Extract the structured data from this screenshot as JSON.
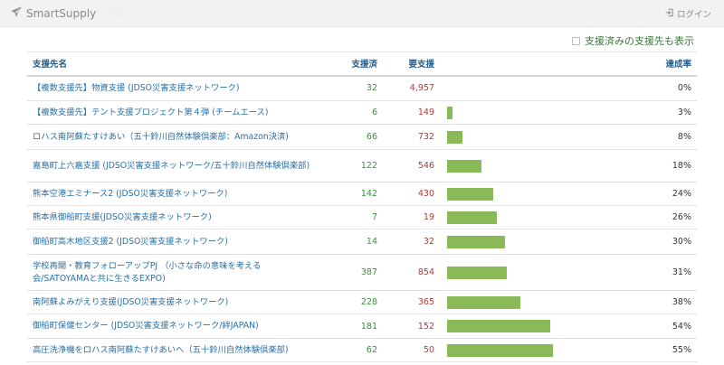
{
  "navbar": {
    "brand": "SmartSupply",
    "subtitle": "支援先",
    "login": "ログイン"
  },
  "filter": {
    "label": "支援済みの支援先も表示",
    "checked": false
  },
  "table": {
    "headers": {
      "name": "支援先名",
      "done": "支援済",
      "need": "要支援",
      "rate": "達成率"
    },
    "rows": [
      {
        "name": "【複数支援先】物資支援 (JDSO災害支援ネットワーク)",
        "done": "32",
        "need": "4,957",
        "rate": "0%",
        "progress": 0.0
      },
      {
        "name": "【複数支援先】テント支援プロジェクト第４弾 (チームエース)",
        "done": "6",
        "need": "149",
        "rate": "3%",
        "progress": 0.03
      },
      {
        "name": "ロハス南阿蘇たすけあい（五十鈴川自然体験倶楽部：Amazon決済)",
        "done": "66",
        "need": "732",
        "rate": "8%",
        "progress": 0.08
      },
      {
        "name": "嘉島町上六嘉支援 (JDSO災害支援ネットワーク/五十鈴川自然体験倶楽部)",
        "done": "122",
        "need": "546",
        "rate": "18%",
        "progress": 0.18
      },
      {
        "name": "熊本空港エミナース2 (JDSO災害支援ネットワーク)",
        "done": "142",
        "need": "430",
        "rate": "24%",
        "progress": 0.24
      },
      {
        "name": "熊本県御船町支援(JDSO災害支援ネットワーク)",
        "done": "7",
        "need": "19",
        "rate": "26%",
        "progress": 0.26
      },
      {
        "name": "御船町高木地区支援2 (JDSO災害支援ネットワーク)",
        "done": "14",
        "need": "32",
        "rate": "30%",
        "progress": 0.3
      },
      {
        "name": "学校再開・教育フォローアップPJ （小さな命の意味を考える会/SATOYAMAと共に生きるEXPO)",
        "done": "387",
        "need": "854",
        "rate": "31%",
        "progress": 0.31
      },
      {
        "name": "南阿蘇よみがえり支援(JDSO災害支援ネットワーク)",
        "done": "228",
        "need": "365",
        "rate": "38%",
        "progress": 0.38
      },
      {
        "name": "御船町保健センター (JDSO災害支援ネットワーク/絆JAPAN)",
        "done": "181",
        "need": "152",
        "rate": "54%",
        "progress": 0.54
      },
      {
        "name": "高圧洗浄機をロハス南阿蘇たすけあいへ（五十鈴川自然体験倶楽部)",
        "done": "62",
        "need": "50",
        "rate": "55%",
        "progress": 0.55
      }
    ]
  },
  "colors": {
    "bar": "#8ab957",
    "done": "#3c8c3c",
    "need": "#b13a3a",
    "link": "#2a6fa5"
  },
  "icons": {
    "brand": "paper-plane-icon",
    "login": "sign-in-icon"
  }
}
